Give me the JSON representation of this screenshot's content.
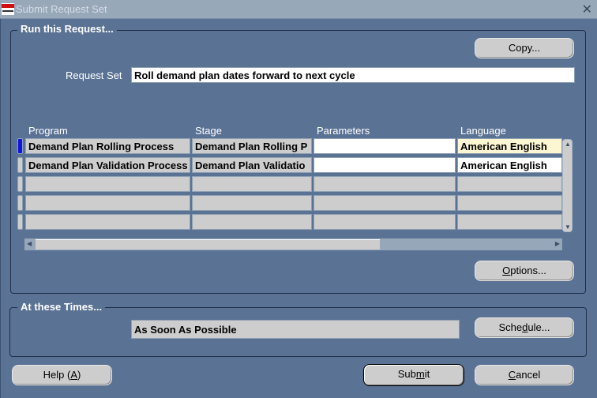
{
  "window": {
    "title": "Submit Request Set",
    "logo_icon": "oracle-applications-logo",
    "close_icon": "close-x"
  },
  "run_section": {
    "title": "Run this Request...",
    "copy_button": "Copy...",
    "request_set_label": "Request Set",
    "request_set_value": "Roll demand plan dates forward to next cycle",
    "columns": [
      "Program",
      "Stage",
      "Parameters",
      "Language"
    ],
    "rows": [
      {
        "program": "Demand Plan Rolling Process",
        "stage": "Demand Plan Rolling P",
        "parameters": "",
        "language": "American English",
        "selected": true
      },
      {
        "program": "Demand Plan Validation Process",
        "stage": "Demand Plan Validatio",
        "parameters": "",
        "language": "American English",
        "selected": false
      },
      {
        "program": "",
        "stage": "",
        "parameters": "",
        "language": "",
        "selected": false
      },
      {
        "program": "",
        "stage": "",
        "parameters": "",
        "language": "",
        "selected": false
      },
      {
        "program": "",
        "stage": "",
        "parameters": "",
        "language": "",
        "selected": false
      }
    ],
    "options_button": {
      "pre": "",
      "mnemonic": "O",
      "post": "ptions..."
    }
  },
  "times_section": {
    "title": "At these Times...",
    "schedule_value": "As Soon As Possible",
    "schedule_button": {
      "pre": "Sche",
      "mnemonic": "d",
      "post": "ule..."
    }
  },
  "footer": {
    "help_button": {
      "pre": "Help (",
      "mnemonic": "A",
      "post": ")"
    },
    "submit_button": {
      "pre": "Sub",
      "mnemonic": "m",
      "post": "it"
    },
    "cancel_button": {
      "pre": "",
      "mnemonic": "C",
      "post": "ancel"
    }
  }
}
